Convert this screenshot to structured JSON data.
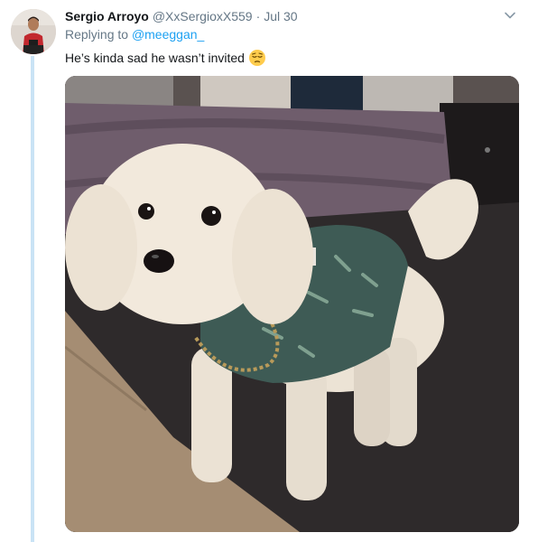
{
  "tweet": {
    "author_name": "Sergio Arroyo",
    "handle": "@XxSergioxX559",
    "separator": "·",
    "time": "Jul 30",
    "reply_prefix": "Replying to",
    "reply_mention": "@meeggan_",
    "text": "He’s kinda sad he wasn’t invited",
    "emoji": "pensive-face-emoji",
    "media_description": "photo of a small white fluffy dog wearing a green tropical-print shirt and a gold chain, standing on a carpet next to a bed"
  },
  "icons": {
    "menu": "chevron-down-icon"
  },
  "colors": {
    "link": "#1da1f2",
    "secondary_text": "#657786",
    "primary_text": "#14171a",
    "thread_line": "#c9e3f5"
  }
}
